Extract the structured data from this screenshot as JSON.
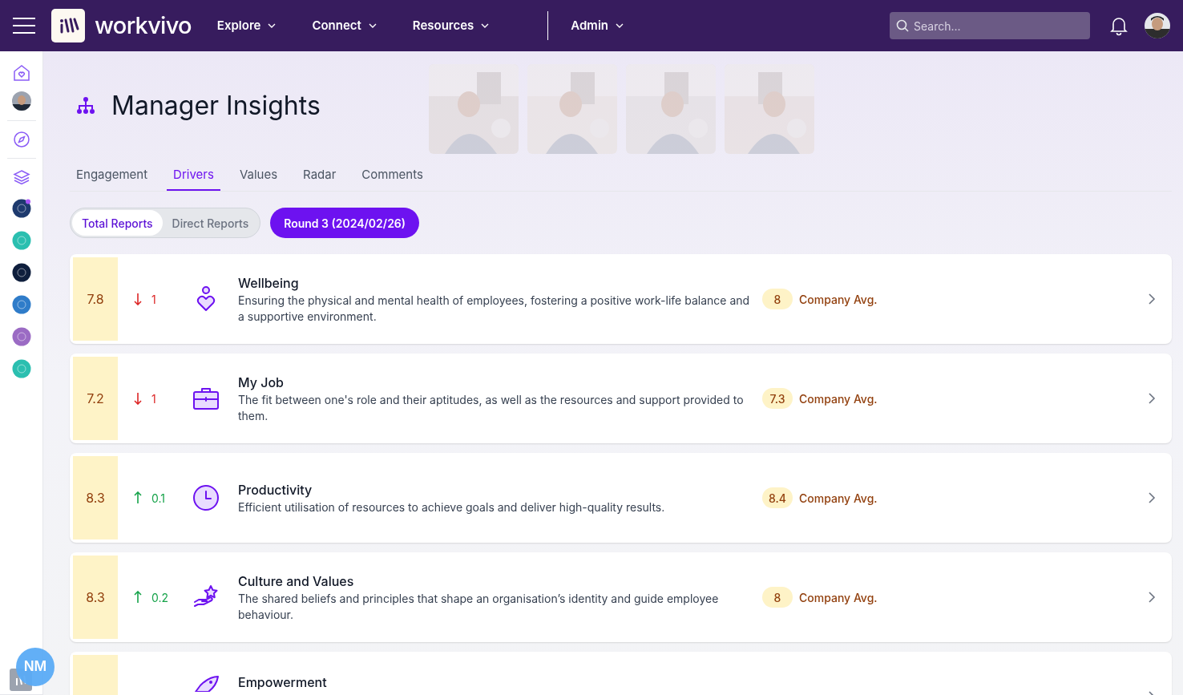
{
  "topbar": {
    "brand": "workvivo",
    "nav": [
      {
        "label": "Explore"
      },
      {
        "label": "Connect"
      },
      {
        "label": "Resources"
      },
      {
        "label": "Admin",
        "separated": true
      }
    ],
    "search": {
      "placeholder": "Search..."
    }
  },
  "sidebar": {
    "spaces": [
      {
        "color": "#1e3a6e",
        "unread": true
      },
      {
        "color": "#2bbfb0",
        "unread": false
      },
      {
        "color": "#0f1f3d",
        "unread": false
      },
      {
        "color": "#2f7cc9",
        "unread": false
      },
      {
        "color": "#9b6bc4",
        "unread": false
      },
      {
        "color": "#2bbfb0",
        "unread": false
      }
    ],
    "user_badge": "NM"
  },
  "page": {
    "title": "Manager Insights",
    "tabs": [
      {
        "label": "Engagement",
        "selected": false
      },
      {
        "label": "Drivers",
        "selected": true
      },
      {
        "label": "Values",
        "selected": false
      },
      {
        "label": "Radar",
        "selected": false
      },
      {
        "label": "Comments",
        "selected": false
      }
    ],
    "scope": [
      {
        "label": "Total Reports",
        "selected": true
      },
      {
        "label": "Direct Reports",
        "selected": false
      }
    ],
    "round": "Round 3 (2024/02/26)"
  },
  "drivers": [
    {
      "kind": "wellbeing",
      "score": "7.8",
      "rising": false,
      "change": "1",
      "name": "Wellbeing",
      "description": "Ensuring the physical and mental health of employees, fostering a positive work-life balance and a supportive environment.",
      "company_avg": "8",
      "avg_label": "Company Avg."
    },
    {
      "kind": "job",
      "score": "7.2",
      "rising": false,
      "change": "1",
      "name": "My Job",
      "description": "The fit between one's role and their aptitudes, as well as the resources and support provided to them.",
      "company_avg": "7.3",
      "avg_label": "Company Avg."
    },
    {
      "kind": "productivity",
      "score": "8.3",
      "rising": true,
      "change": "0.1",
      "name": "Productivity",
      "description": "Efficient utilisation of resources to achieve goals and deliver high-quality results.",
      "company_avg": "8.4",
      "avg_label": "Company Avg."
    },
    {
      "kind": "culture",
      "score": "8.3",
      "rising": true,
      "change": "0.2",
      "name": "Culture and Values",
      "description": "The shared beliefs and principles that shape an organisation’s identity and guide employee behaviour.",
      "company_avg": "8",
      "avg_label": "Company Avg."
    },
    {
      "kind": "empowerment",
      "name": "Empowerment"
    }
  ]
}
